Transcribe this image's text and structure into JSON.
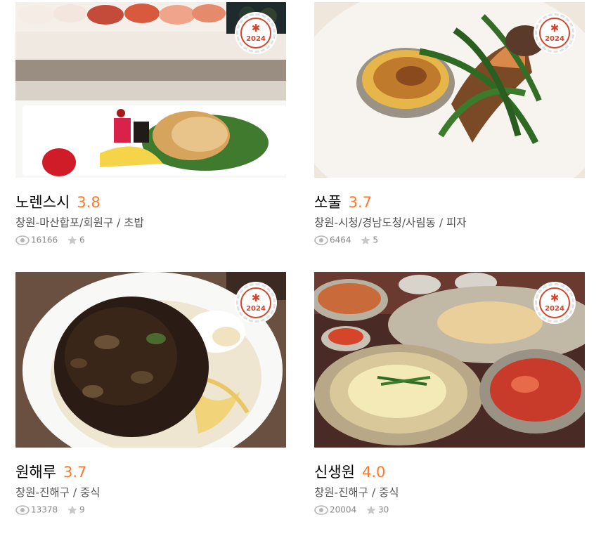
{
  "restaurants": [
    {
      "name": "노렌스시",
      "score": "3.8",
      "region": "창원-마산합포/회원구 / 초밥",
      "views": "16166",
      "reviews": "6",
      "badge_year": "2024",
      "badge_symbol": "✱",
      "image_icon": "sushi-photo"
    },
    {
      "name": "쏘풀",
      "score": "3.7",
      "region": "창원-시청/경남도청/사림동 / 피자",
      "views": "6464",
      "reviews": "5",
      "badge_year": "2024",
      "badge_symbol": "✱",
      "image_icon": "gratin-photo"
    },
    {
      "name": "원해루",
      "score": "3.7",
      "region": "창원-진해구 / 중식",
      "views": "13378",
      "reviews": "9",
      "badge_year": "2024",
      "badge_symbol": "✱",
      "image_icon": "jajangmyeon-photo"
    },
    {
      "name": "신생원",
      "score": "4.0",
      "region": "창원-진해구 / 중식",
      "views": "20004",
      "reviews": "30",
      "badge_year": "2024",
      "badge_symbol": "✱",
      "image_icon": "naengmyeon-photo"
    }
  ],
  "colors": {
    "score": "#ff792a",
    "badge": "#d2462b",
    "meta": "#555555",
    "stats": "#888888"
  }
}
